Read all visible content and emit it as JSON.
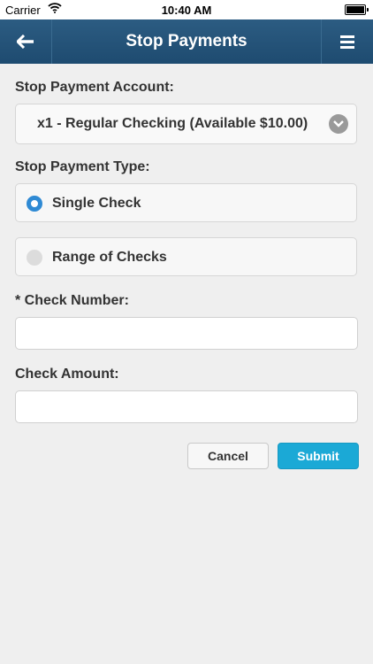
{
  "status_bar": {
    "carrier": "Carrier",
    "time": "10:40 AM"
  },
  "header": {
    "title": "Stop Payments",
    "back_icon": "arrow-left-icon",
    "menu_icon": "hamburger-menu-icon"
  },
  "form": {
    "account_label": "Stop Payment Account:",
    "account_value": "x1 - Regular Checking (Available $10.00)",
    "type_label": "Stop Payment Type:",
    "type_options": [
      {
        "label": "Single Check",
        "selected": true
      },
      {
        "label": "Range of Checks",
        "selected": false
      }
    ],
    "check_number_label": "* Check Number:",
    "check_number_value": "",
    "check_amount_label": "Check Amount:",
    "check_amount_value": ""
  },
  "actions": {
    "cancel_label": "Cancel",
    "submit_label": "Submit"
  },
  "colors": {
    "header": "#1e4b70",
    "accent": "#2f8ad4",
    "submit": "#1ba9d6"
  }
}
